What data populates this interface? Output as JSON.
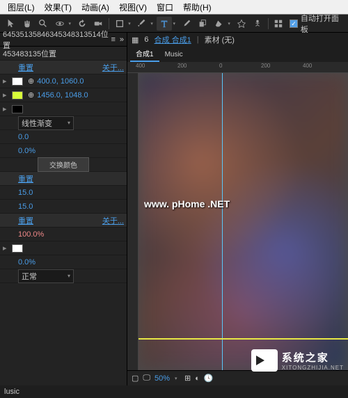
{
  "menu": {
    "layer": "图层(L)",
    "effect": "效果(T)",
    "anim": "动画(A)",
    "view": "视图(V)",
    "window": "窗口",
    "help": "帮助(H)"
  },
  "toolbar": {
    "autoOpen": "自动打开面板"
  },
  "left": {
    "tabTitle": "64535135846345348313514位置",
    "posHeader": "453483135位置",
    "reset": "重置",
    "about": "关于...",
    "pos1": "400.0, 1060.0",
    "pos2": "1456.0, 1048.0",
    "gradType": "线性渐变",
    "zero": "0.0",
    "zeroPct": "0.0%",
    "swap": "交换颜色",
    "v15a": "15.0",
    "v15b": "15.0",
    "pct100": "100.0%",
    "blend": "正常"
  },
  "right": {
    "crumb1": "6",
    "crumb2": "合成 合成1",
    "crumb3": "素材 (无)",
    "tab1": "合成1",
    "tab2": "Music",
    "ticks": [
      "400",
      "200",
      "0",
      "200",
      "400"
    ],
    "zoom": "50%"
  },
  "status": {
    "text": "lusic"
  },
  "wm": "www. pHome .NET",
  "brand": {
    "cn": "系统之家",
    "en": "XITONGZHIJIA.NET"
  }
}
